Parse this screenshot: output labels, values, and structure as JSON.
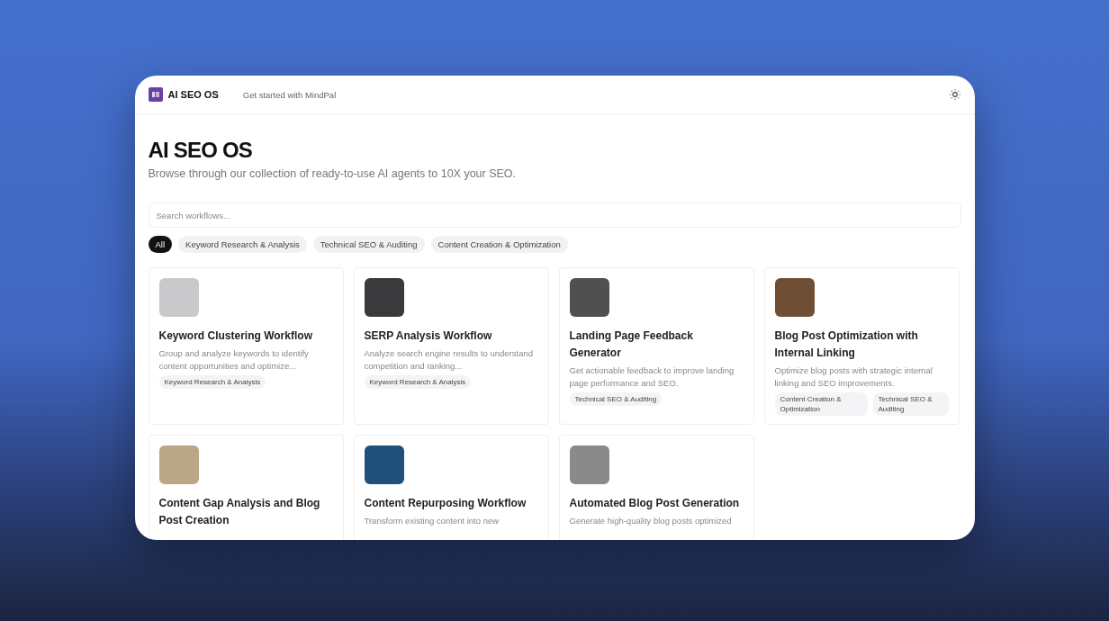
{
  "header": {
    "brand": "AI SEO OS",
    "link": "Get started with MindPal"
  },
  "page": {
    "title": "AI SEO OS",
    "subtitle": "Browse through our collection of ready-to-use AI agents to 10X your SEO."
  },
  "search": {
    "placeholder": "Search workflows..."
  },
  "filters": [
    {
      "label": "All",
      "selected": true
    },
    {
      "label": "Keyword Research & Analysis",
      "selected": false
    },
    {
      "label": "Technical SEO & Auditing",
      "selected": false
    },
    {
      "label": "Content Creation & Optimization",
      "selected": false
    }
  ],
  "cards": [
    {
      "title": "Keyword Clustering Workflow",
      "description": "Group and analyze keywords to identify content opportunities and optimize...",
      "tags": [
        "Keyword Research & Analysis"
      ],
      "color": "#c9c9cc"
    },
    {
      "title": "SERP Analysis Workflow",
      "description": "Analyze search engine results to understand competition and ranking...",
      "tags": [
        "Keyword Research & Analysis"
      ],
      "color": "#3a3a3c"
    },
    {
      "title": "Landing Page Feedback Generator",
      "description": "Get actionable feedback to improve landing page performance and SEO.",
      "tags": [
        "Technical SEO & Auditing"
      ],
      "color": "#505050"
    },
    {
      "title": "Blog Post Optimization with Internal Linking",
      "description": "Optimize blog posts with strategic internal linking and SEO improvements.",
      "tags": [
        "Content Creation & Optimization",
        "Technical SEO & Auditing"
      ],
      "color": "#6e4f36"
    },
    {
      "title": "Content Gap Analysis and Blog Post Creation",
      "color": "#b9a785"
    },
    {
      "title": "Content Repurposing Workflow",
      "description": "Transform existing content into new",
      "color": "#1f4f7a"
    },
    {
      "title": "Automated Blog Post Generation",
      "description": "Generate high-quality blog posts optimized",
      "color": "#8a8a8a"
    }
  ]
}
